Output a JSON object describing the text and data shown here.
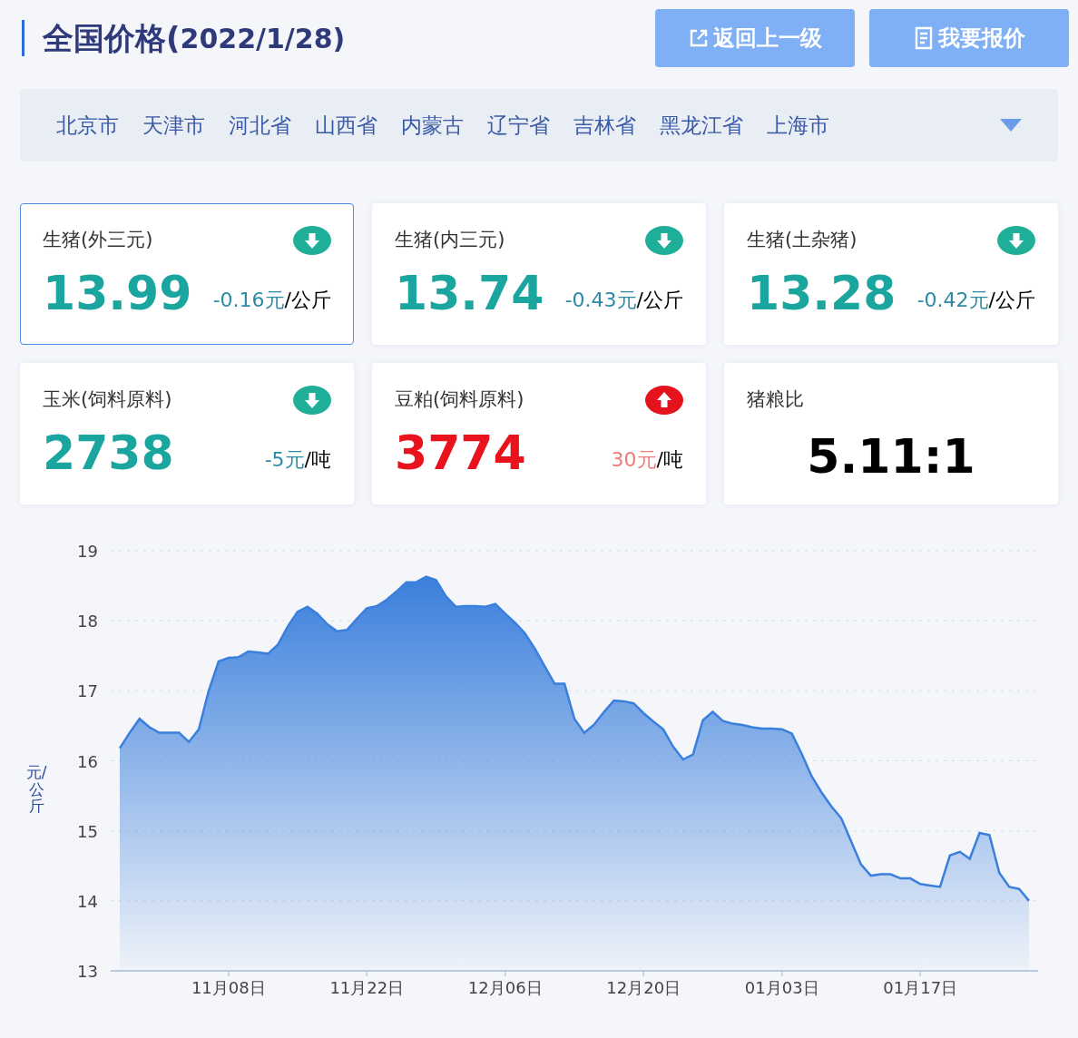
{
  "header": {
    "title": "全国价格(",
    "date": "2022/1/28)",
    "buttons": [
      "返回上一级",
      "我要报价"
    ]
  },
  "regions": [
    "北京市",
    "天津市",
    "河北省",
    "山西省",
    "内蒙古",
    "辽宁省",
    "吉林省",
    "黑龙江省",
    "上海市"
  ],
  "cards": [
    {
      "kind": "fall",
      "name": "生猪(外三元)",
      "value": "13.99",
      "change": "-0.16元",
      "unit": "/公斤",
      "selected": true
    },
    {
      "kind": "fall",
      "name": "生猪(内三元)",
      "value": "13.74",
      "change": "-0.43元",
      "unit": "/公斤",
      "selected": false
    },
    {
      "kind": "fall",
      "name": "生猪(土杂猪)",
      "value": "13.28",
      "change": "-0.42元",
      "unit": "/公斤",
      "selected": false
    },
    {
      "kind": "fall",
      "name": "玉米(饲料原料)",
      "value": "2738",
      "change": "-5元",
      "unit": "/吨",
      "selected": false
    },
    {
      "kind": "rise",
      "name": "豆粕(饲料原料)",
      "value": "3774",
      "change": "30元",
      "unit": "/吨",
      "selected": false
    },
    {
      "kind": "ratio",
      "name": "猪粮比",
      "value": "5.11:1",
      "selected": false
    }
  ],
  "chart": {
    "chart_data": {
      "type": "area",
      "grid": true,
      "ylabel": "元/公斤",
      "ylim": [
        13,
        19
      ],
      "yticks": [
        13,
        14,
        15,
        16,
        17,
        18,
        19
      ],
      "categories": [
        null,
        null,
        null,
        null,
        null,
        null,
        null,
        null,
        null,
        null,
        null,
        "11月08日",
        null,
        null,
        null,
        null,
        null,
        null,
        null,
        null,
        null,
        null,
        null,
        null,
        null,
        "11月22日",
        null,
        null,
        null,
        null,
        null,
        null,
        null,
        null,
        null,
        null,
        null,
        null,
        null,
        "12月06日",
        null,
        null,
        null,
        null,
        null,
        null,
        null,
        null,
        null,
        null,
        null,
        null,
        null,
        "12月20日",
        null,
        null,
        null,
        null,
        null,
        null,
        null,
        null,
        null,
        null,
        null,
        null,
        null,
        "01月03日",
        null,
        null,
        null,
        null,
        null,
        null,
        null,
        null,
        null,
        null,
        null,
        null,
        null,
        "01月17日",
        null,
        null,
        null,
        null,
        null,
        null,
        null,
        null,
        null,
        null,
        null
      ],
      "series": [
        {
          "color": "#3a7fdc",
          "values": [
            16.18,
            16.4,
            16.6,
            16.48,
            16.4,
            16.4,
            16.4,
            16.27,
            16.45,
            17.0,
            17.42,
            17.47,
            17.48,
            17.56,
            17.55,
            17.53,
            17.66,
            17.92,
            18.13,
            18.2,
            18.1,
            17.95,
            17.85,
            17.87,
            18.03,
            18.18,
            18.21,
            18.3,
            18.42,
            18.55,
            18.55,
            18.63,
            18.58,
            18.35,
            18.2,
            18.21,
            18.21,
            18.2,
            18.24,
            18.1,
            17.97,
            17.82,
            17.6,
            17.35,
            17.1,
            17.1,
            16.6,
            16.4,
            16.52,
            16.7,
            16.86,
            16.85,
            16.82,
            16.68,
            16.56,
            16.45,
            16.2,
            16.02,
            16.09,
            16.58,
            16.7,
            16.57,
            16.53,
            16.51,
            16.48,
            16.46,
            16.46,
            16.45,
            16.39,
            16.1,
            15.78,
            15.55,
            15.35,
            15.18,
            14.85,
            14.52,
            14.36,
            14.38,
            14.38,
            14.32,
            14.32,
            14.24,
            14.22,
            14.2,
            14.65,
            14.7,
            14.6,
            14.97,
            14.94,
            14.4,
            14.2,
            14.17,
            14.0
          ]
        }
      ]
    }
  }
}
